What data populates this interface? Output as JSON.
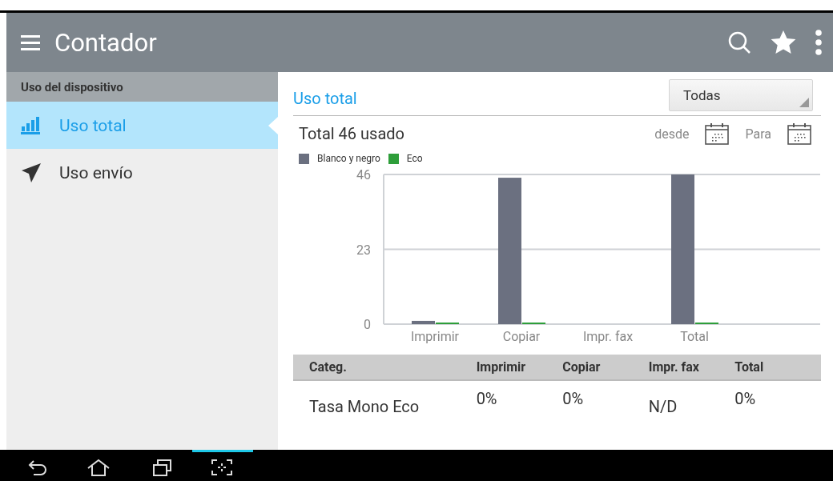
{
  "app_bar": {
    "title": "Contador"
  },
  "sidebar": {
    "header": "Uso del dispositivo",
    "items": [
      {
        "label": "Uso total",
        "kind": "bars",
        "selected": true
      },
      {
        "label": "Uso envío",
        "kind": "send",
        "selected": false
      }
    ]
  },
  "panel": {
    "title": "Uso total",
    "filter": {
      "value": "Todas"
    },
    "summary": "Total 46 usado",
    "from_label": "desde",
    "to_label": "Para",
    "chart_data": {
      "type": "bar",
      "categories": [
        "Imprimir",
        "Copiar",
        "Impr. fax",
        "Total"
      ],
      "series": [
        {
          "name": "Blanco y negro",
          "color": "#6b7080",
          "values": [
            1,
            45,
            null,
            46
          ]
        },
        {
          "name": "Eco",
          "color": "#2e9e3a",
          "values": [
            0,
            0,
            null,
            0
          ]
        }
      ],
      "ylim": [
        0,
        46
      ],
      "yticks": [
        0,
        23,
        46
      ]
    },
    "table": {
      "columns": [
        "Categ.",
        "Imprimir",
        "Copiar",
        "Impr. fax",
        "Total"
      ],
      "rows": [
        [
          "Tasa Mono Eco",
          "0%",
          "0%",
          "N/D",
          "0%"
        ]
      ]
    }
  }
}
